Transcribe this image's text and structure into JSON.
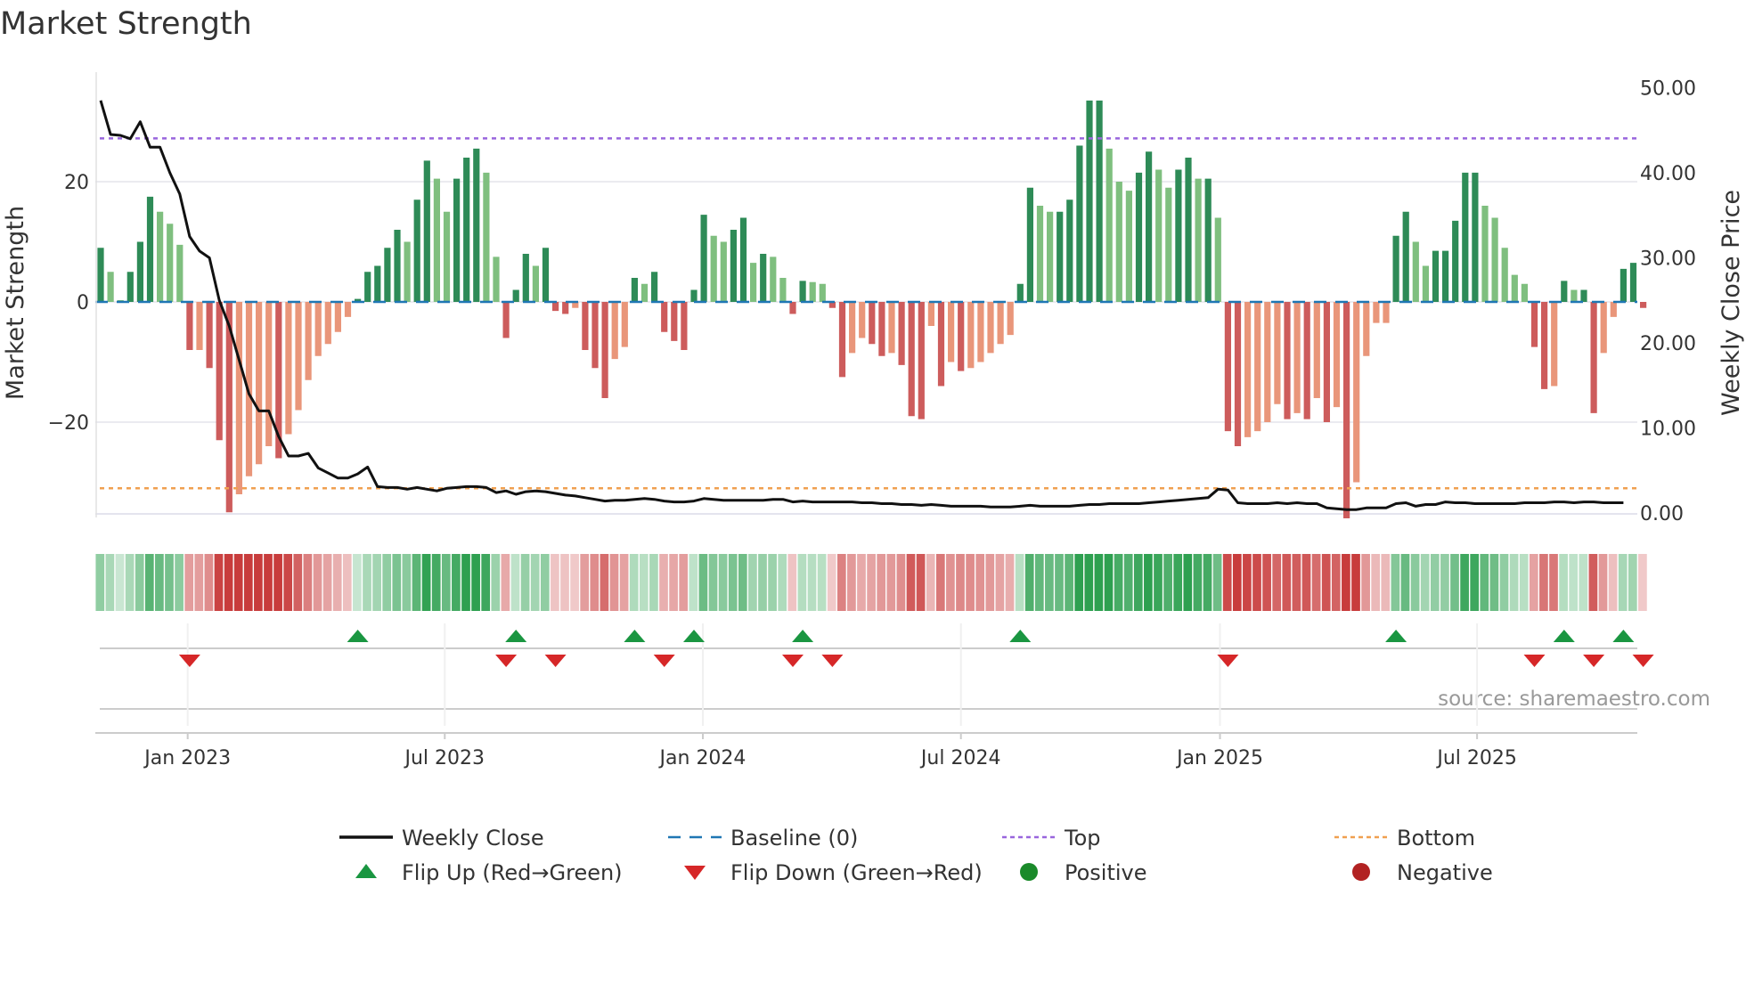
{
  "chart_data": {
    "type": "bar",
    "title": "Market Strength",
    "ylabel": "Market Strength",
    "y2label": "Weekly Close Price",
    "ylim": [
      -35.2,
      38
    ],
    "y2lim": [
      0,
      51.8
    ],
    "yticks": [
      {
        "v": 20,
        "label": "20"
      },
      {
        "v": 0,
        "label": "0"
      },
      {
        "v": -20,
        "label": "−20"
      }
    ],
    "y2ticks": [
      {
        "v": 50,
        "label": "50.00"
      },
      {
        "v": 40,
        "label": "40.00"
      },
      {
        "v": 30,
        "label": "30.00"
      },
      {
        "v": 20,
        "label": "20.00"
      },
      {
        "v": 10,
        "label": "10.00"
      },
      {
        "v": 0,
        "label": "0.00"
      }
    ],
    "xticks": [
      {
        "week": 8.8,
        "label": "Jan 2023"
      },
      {
        "week": 34.8,
        "label": "Jul 2023"
      },
      {
        "week": 60.9,
        "label": "Jan 2024"
      },
      {
        "week": 87,
        "label": "Jul 2024"
      },
      {
        "week": 113.2,
        "label": "Jan 2025"
      },
      {
        "week": 139.2,
        "label": "Jul 2025"
      }
    ],
    "top_level": 27.2,
    "bottom_level": -31,
    "strength": [
      9,
      5,
      0.3,
      5,
      10,
      17.5,
      15,
      13,
      9.5,
      -8,
      -8,
      -11,
      -23,
      -35,
      -32,
      -29,
      -27,
      -24,
      -26,
      -22,
      -18,
      -13,
      -9,
      -7,
      -5,
      -2.5,
      0.5,
      5,
      6,
      9,
      12,
      10,
      17,
      23.5,
      20.5,
      15,
      20.5,
      24,
      25.5,
      21.5,
      7.5,
      -6,
      2,
      8,
      6,
      9,
      -1.5,
      -2,
      -1,
      -8,
      -11,
      -16,
      -9.5,
      -7.5,
      4,
      3,
      5,
      -5,
      -6.5,
      -8,
      2,
      14.5,
      11,
      10,
      12,
      14,
      6.5,
      8,
      7.5,
      4,
      -2,
      3.5,
      3.3,
      3,
      -1,
      -12.5,
      -8.5,
      -6,
      -7,
      -9,
      -8.5,
      -10.5,
      -19,
      -19.5,
      -4,
      -14,
      -10,
      -11.5,
      -11,
      -10,
      -8.5,
      -7,
      -5.5,
      3,
      19,
      16,
      15,
      15,
      17,
      26,
      33.5,
      33.5,
      25.5,
      20,
      18.5,
      21.5,
      25,
      22,
      19,
      22,
      24,
      20.5,
      20.5,
      14,
      -21.5,
      -24,
      -22.5,
      -21.5,
      -20,
      -17,
      -19.5,
      -18.5,
      -19.5,
      -16,
      -20,
      -17.5,
      -36,
      -30,
      -9,
      -3.5,
      -3.5,
      11,
      15,
      10,
      6,
      8.5,
      8.5,
      13.5,
      21.5,
      21.5,
      16,
      14,
      9,
      4.5,
      3,
      -7.5,
      -14.5,
      -14,
      3.5,
      2,
      2,
      -18.5,
      -8.5,
      -2.5,
      5.5,
      6.5,
      -1
    ],
    "close": [
      48.5,
      44.5,
      44.4,
      44,
      46,
      43,
      43,
      40,
      37.5,
      32.5,
      30.8,
      30,
      25,
      22,
      18,
      14,
      12,
      12,
      9,
      6.7,
      6.7,
      7,
      5.3,
      4.7,
      4.1,
      4.1,
      4.6,
      5.4,
      3.1,
      3,
      3,
      2.8,
      3,
      2.8,
      2.6,
      2.9,
      3,
      3.1,
      3.1,
      3,
      2.4,
      2.6,
      2.2,
      2.5,
      2.6,
      2.5,
      2.3,
      2.1,
      2,
      1.8,
      1.6,
      1.4,
      1.5,
      1.5,
      1.6,
      1.7,
      1.6,
      1.4,
      1.3,
      1.3,
      1.4,
      1.7,
      1.6,
      1.5,
      1.5,
      1.5,
      1.5,
      1.5,
      1.6,
      1.6,
      1.3,
      1.4,
      1.3,
      1.3,
      1.3,
      1.3,
      1.3,
      1.2,
      1.2,
      1.1,
      1.1,
      1.0,
      1.0,
      0.9,
      1.0,
      0.9,
      0.8,
      0.8,
      0.8,
      0.8,
      0.7,
      0.7,
      0.7,
      0.8,
      0.9,
      0.8,
      0.8,
      0.8,
      0.8,
      0.9,
      1.0,
      1.0,
      1.1,
      1.1,
      1.1,
      1.1,
      1.2,
      1.3,
      1.4,
      1.5,
      1.6,
      1.7,
      1.8,
      2.8,
      2.7,
      1.2,
      1.1,
      1.1,
      1.1,
      1.2,
      1.1,
      1.2,
      1.1,
      1.1,
      0.6,
      0.5,
      0.4,
      0.4,
      0.6,
      0.6,
      0.6,
      1.1,
      1.2,
      0.8,
      1.0,
      1.0,
      1.3,
      1.2,
      1.2,
      1.1,
      1.1,
      1.1,
      1.1,
      1.1,
      1.2,
      1.2,
      1.2,
      1.3,
      1.3,
      1.2,
      1.3,
      1.3,
      1.2,
      1.2,
      1.2
    ],
    "colors": {
      "up_strong": "#2e8b57",
      "up_weak": "#7fbf7f",
      "down_strong": "#cd5c5c",
      "down_weak": "#e9967a",
      "top": "#9966dd",
      "bottom": "#f0a050",
      "baseline": "#1f77b4",
      "flip_up": "#1a9641",
      "flip_down": "#d62728"
    },
    "source": "source: sharemaestro.com",
    "legend": [
      {
        "label": "Weekly Close",
        "kind": "line",
        "color": "#111111"
      },
      {
        "label": "Baseline (0)",
        "kind": "dash",
        "color": "#1f77b4"
      },
      {
        "label": "Top",
        "kind": "dot",
        "color": "#9966dd"
      },
      {
        "label": "Bottom",
        "kind": "dot",
        "color": "#f0a050"
      },
      {
        "label": "Flip Up (Red→Green)",
        "kind": "tri-up",
        "color": "#1a9641"
      },
      {
        "label": "Flip Down (Green→Red)",
        "kind": "tri-down",
        "color": "#d62728"
      },
      {
        "label": "Positive",
        "kind": "circle",
        "color": "#1a8a2a"
      },
      {
        "label": "Negative",
        "kind": "circle",
        "color": "#b22222"
      }
    ]
  }
}
